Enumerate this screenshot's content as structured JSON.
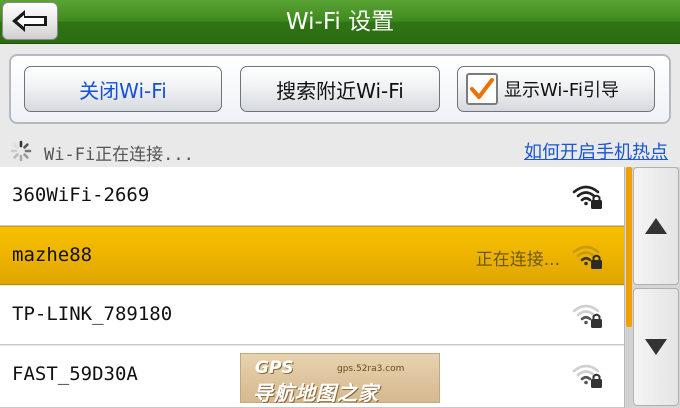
{
  "header": {
    "title": "Wi-Fi 设置",
    "back_icon": "back-arrow-icon"
  },
  "buttons": {
    "wifi_off": "关闭Wi-Fi",
    "search": "搜索附近Wi-Fi",
    "guide": "显示Wi-Fi引导",
    "guide_checked": true
  },
  "status": {
    "text": "Wi-Fi正在连接...",
    "hotspot_link": "如何开启手机热点"
  },
  "networks": [
    {
      "ssid": "360WiFi-2669",
      "status": "",
      "icon": "wifi-locked-icon",
      "signal": "full",
      "selected": false
    },
    {
      "ssid": "mazhe88",
      "status": "正在连接...",
      "icon": "wifi-locked-icon",
      "signal": "weak",
      "selected": true
    },
    {
      "ssid": "TP-LINK_789180",
      "status": "",
      "icon": "wifi-locked-icon",
      "signal": "weak",
      "selected": false
    },
    {
      "ssid": "FAST_59D30A",
      "status": "",
      "icon": "wifi-locked-icon",
      "signal": "weak",
      "selected": false
    }
  ],
  "watermark": {
    "logo": "GPS",
    "url": "gps.52ra3.com",
    "name": "导航地图之家"
  },
  "colors": {
    "header_green": "#3f8a1f",
    "selected_row": "#edb300",
    "link_blue": "#1a55d4",
    "accent_orange": "#f0a000"
  }
}
